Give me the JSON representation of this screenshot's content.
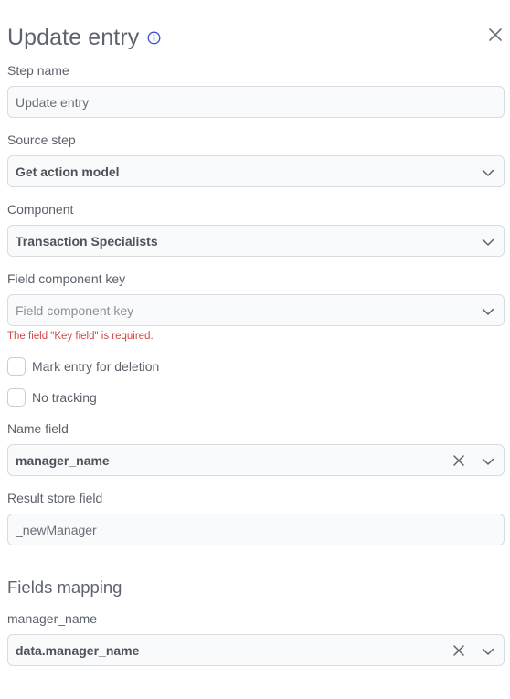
{
  "header": {
    "title": "Update entry"
  },
  "step_name": {
    "label": "Step name",
    "value": "Update entry"
  },
  "source_step": {
    "label": "Source step",
    "value": "Get action model"
  },
  "component": {
    "label": "Component",
    "value": "Transaction Specialists"
  },
  "field_component_key": {
    "label": "Field component key",
    "placeholder": "Field component key",
    "error": "The field \"Key field\" is required."
  },
  "mark_deletion": {
    "label": "Mark entry for deletion",
    "checked": false
  },
  "no_tracking": {
    "label": "No tracking",
    "checked": false
  },
  "name_field": {
    "label": "Name field",
    "value": "manager_name"
  },
  "result_store_field": {
    "label": "Result store field",
    "value": "_newManager"
  },
  "fields_mapping": {
    "title": "Fields mapping",
    "items": [
      {
        "label": "manager_name",
        "value": "data.manager_name"
      }
    ]
  }
}
